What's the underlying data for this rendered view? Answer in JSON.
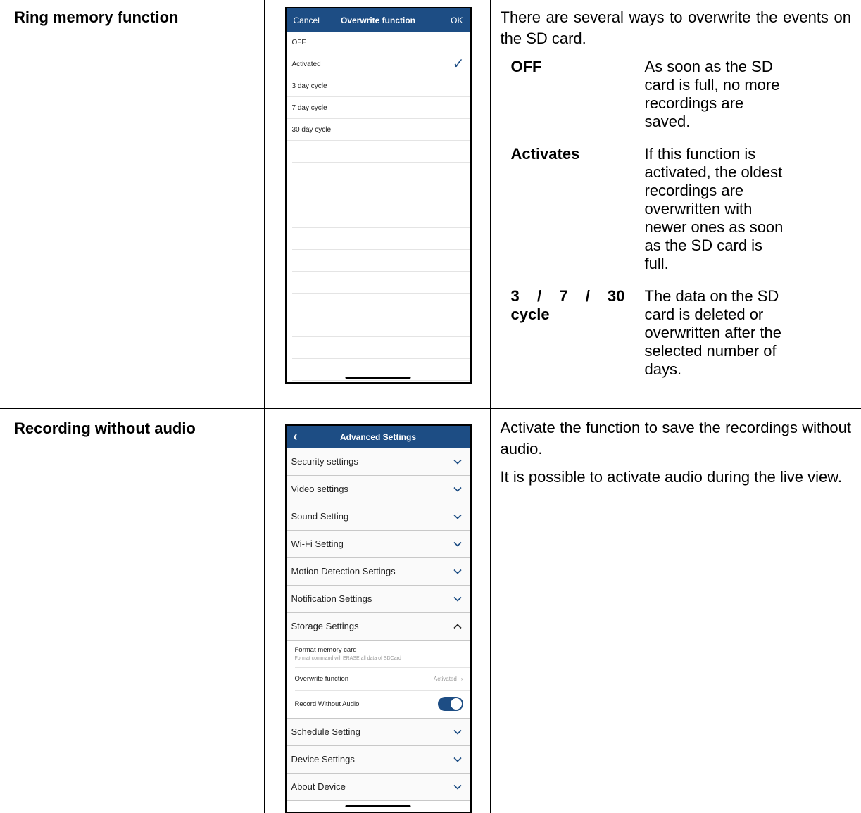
{
  "row1": {
    "title": "Ring memory function",
    "phone": {
      "cancel": "Cancel",
      "title": "Overwrite function",
      "ok": "OK",
      "options": [
        "OFF",
        "Activated",
        "3 day cycle",
        "7 day cycle",
        "30 day cycle"
      ],
      "selected_index": 1
    },
    "intro": "There are several ways to overwrite the events on the SD card.",
    "options": [
      {
        "key": "OFF",
        "desc": "As soon as the SD card is full, no more recordings are saved."
      },
      {
        "key": "Activates",
        "desc": "If this function is activated, the oldest recordings are overwritten with newer ones as soon as the SD card is full."
      },
      {
        "key_parts": [
          "3",
          "/",
          "7",
          "/",
          "30"
        ],
        "key_line2": "cycle",
        "desc": "The data on the SD card is deleted or overwritten after the selected number of days."
      }
    ]
  },
  "row2": {
    "title": "Recording without audio",
    "phone": {
      "title": "Advanced Settings",
      "sections_top": [
        "Security settings",
        "Video settings",
        "Sound Setting",
        "Wi-Fi Setting",
        "Motion Detection Settings",
        "Notification Settings"
      ],
      "storage": "Storage Settings",
      "format_label": "Format memory card",
      "format_note": "Format command will ERASE all data of SDCard",
      "overwrite_label": "Overwrite function",
      "overwrite_value": "Activated",
      "record_label": "Record Without Audio",
      "record_on": true,
      "sections_bottom": [
        "Schedule Setting",
        "Device Settings",
        "About Device"
      ]
    },
    "paragraphs": [
      "Activate the function to save the recordings without audio.",
      "It is possible to activate audio during the live view."
    ]
  },
  "colors": {
    "nav": "#1d4d84",
    "accent": "#1d4d84"
  }
}
